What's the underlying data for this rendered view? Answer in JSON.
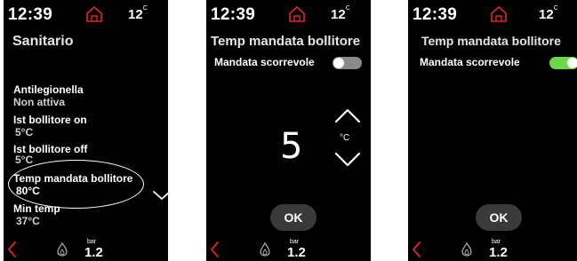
{
  "status": {
    "time": "12:39",
    "temperature": "12",
    "temperature_unit": "C"
  },
  "screen1": {
    "title": "Sanitario",
    "items": [
      {
        "label": "Antilegionella",
        "value": "Non attiva"
      },
      {
        "label": "Ist bollitore on",
        "value": "5°C"
      },
      {
        "label": "Ist bollitore off",
        "value": "5°C"
      },
      {
        "label": "Temp mandata bollitore",
        "value": "80°C"
      },
      {
        "label": "Min temp",
        "value": "37°C"
      }
    ]
  },
  "screen2": {
    "title": "Temp mandata bollitore",
    "option_label": "Mandata scorrevole",
    "toggle_on": false,
    "value": "5",
    "unit": "°C",
    "ok_label": "OK"
  },
  "screen3": {
    "title": "Temp mandata bollitore",
    "option_label": "Mandata scorrevole",
    "toggle_on": true,
    "ok_label": "OK"
  },
  "footer": {
    "pressure_unit": "bar",
    "pressure_value": "1.2"
  },
  "colors": {
    "back_arrow": "#e0262a",
    "home_icon": "#e0262a",
    "toggle_off": "#8a8a8a",
    "toggle_on": "#6fd64a"
  },
  "icons": [
    "home-icon",
    "back-arrow-icon",
    "flame-icon",
    "chevron-up-icon",
    "chevron-down-icon"
  ]
}
